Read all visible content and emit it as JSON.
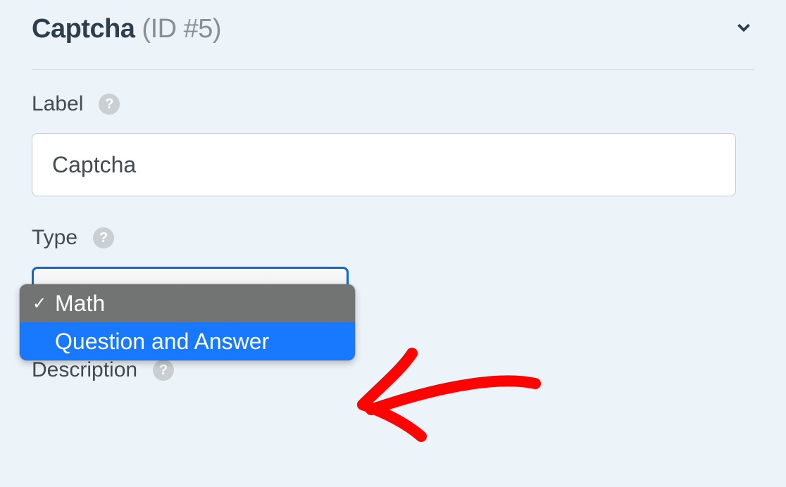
{
  "header": {
    "title": "Captcha",
    "id_label": "(ID #5)"
  },
  "fields": {
    "label": {
      "title": "Label",
      "value": "Captcha"
    },
    "type": {
      "title": "Type",
      "options": [
        {
          "label": "Math",
          "selected": true
        },
        {
          "label": "Question and Answer",
          "selected": false
        }
      ]
    },
    "description": {
      "title": "Description"
    }
  },
  "annotation_color": "#ff0000"
}
